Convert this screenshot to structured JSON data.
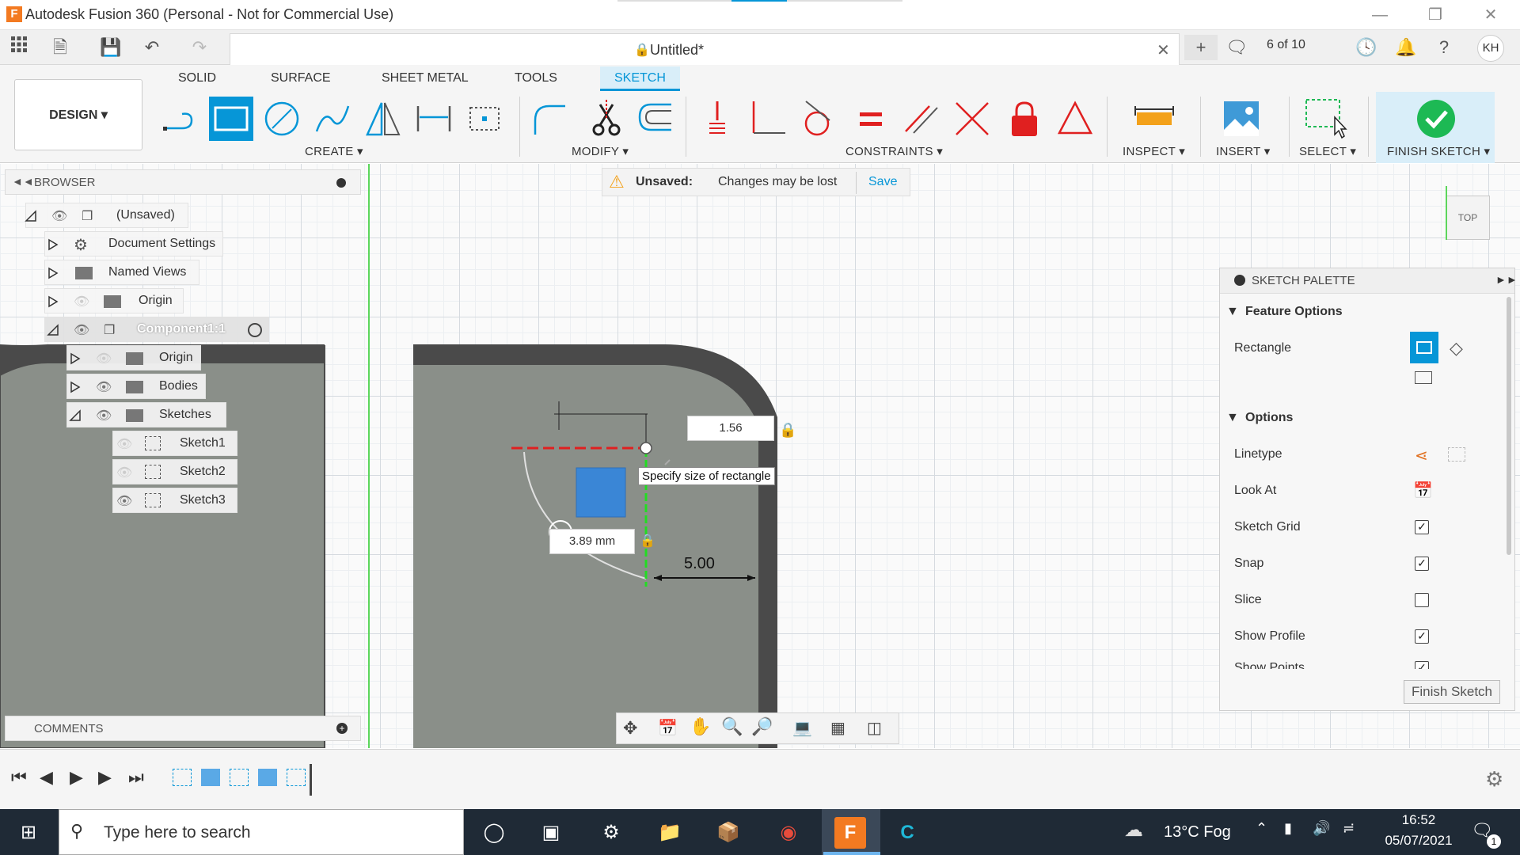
{
  "window": {
    "title": "Autodesk Fusion 360 (Personal - Not for Commercial Use)",
    "app_icon_letter": "F"
  },
  "document": {
    "tab_title": "Untitled*",
    "close_glyph": "✕",
    "version_count": "6 of 10",
    "user_initials": "KH"
  },
  "toolbar": {
    "design_label": "DESIGN",
    "tabs": [
      "SOLID",
      "SURFACE",
      "SHEET METAL",
      "TOOLS",
      "SKETCH"
    ],
    "active_tab": "SKETCH",
    "groups": {
      "create": "CREATE",
      "modify": "MODIFY",
      "constraints": "CONSTRAINTS",
      "inspect": "INSPECT",
      "insert": "INSERT",
      "select": "SELECT",
      "finish": "FINISH SKETCH"
    }
  },
  "browser": {
    "header": "BROWSER",
    "items": [
      {
        "label": "(Unsaved)"
      },
      {
        "label": "Document Settings"
      },
      {
        "label": "Named Views"
      },
      {
        "label": "Origin"
      },
      {
        "label": "Component1:1"
      },
      {
        "label": "Origin"
      },
      {
        "label": "Bodies"
      },
      {
        "label": "Sketches"
      },
      {
        "label": "Sketch1"
      },
      {
        "label": "Sketch2"
      },
      {
        "label": "Sketch3"
      }
    ]
  },
  "warning": {
    "label": "Unsaved:",
    "message": "Changes may be lost",
    "save": "Save"
  },
  "viewcube": {
    "label": "TOP"
  },
  "sketch": {
    "dim_input_value": "1.56",
    "dim_radius": "3.89 mm",
    "dim_length": "5.00",
    "tooltip": "Specify size of rectangle"
  },
  "palette": {
    "title": "SKETCH PALETTE",
    "feature_options": "Feature Options",
    "rectangle": "Rectangle",
    "options": "Options",
    "rows": [
      {
        "label": "Linetype"
      },
      {
        "label": "Look At"
      },
      {
        "label": "Sketch Grid",
        "checked": true
      },
      {
        "label": "Snap",
        "checked": true
      },
      {
        "label": "Slice",
        "checked": false
      },
      {
        "label": "Show Profile",
        "checked": true
      },
      {
        "label": "Show Points",
        "checked": true
      }
    ],
    "finish_button": "Finish Sketch"
  },
  "comments": {
    "label": "COMMENTS"
  },
  "taskbar": {
    "search_placeholder": "Type here to search",
    "weather": "13°C  Fog",
    "time": "16:52",
    "date": "05/07/2021",
    "notification_count": "1"
  },
  "colors": {
    "accent": "#0696d7",
    "body_gray": "#8a8f89",
    "body_dark": "#4a4a4a",
    "finish_green": "#1db954",
    "sketch_red": "#e02020"
  }
}
